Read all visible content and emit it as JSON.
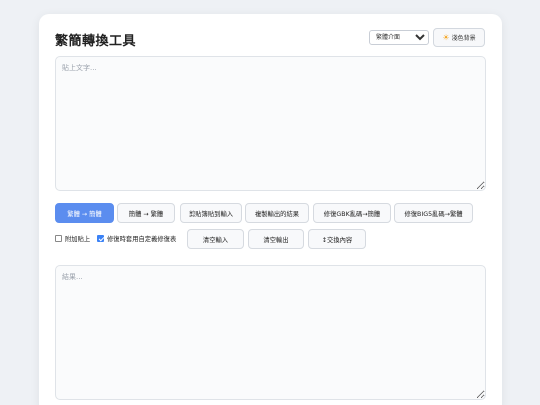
{
  "app": {
    "title": "繁簡轉換工具"
  },
  "header": {
    "mode_select": {
      "selected": "繁體介面",
      "options": [
        "繁體介面"
      ]
    },
    "theme_button": {
      "label": "淺色背景",
      "icon": "sun-icon",
      "icon_color": "#f5a623"
    }
  },
  "input": {
    "placeholder": "貼上文字...",
    "value": ""
  },
  "actions": {
    "trad_to_simp": "繁體 → 簡體",
    "simp_to_trad": "簡體 → 繁體",
    "paste_clipboard": "剪貼簿貼到輸入",
    "copy_output": "複製輸出的結果",
    "fix_gbk": "修復GBK亂碼→簡體",
    "fix_big5": "修復BIG5亂碼→繁體"
  },
  "options": {
    "append_paste": {
      "label": "附加貼上",
      "checked": false
    },
    "custom_table": {
      "label": "修復時套用自定義修復表",
      "checked": true
    }
  },
  "actions2": {
    "clear_input": "清空輸入",
    "clear_output": "清空輸出",
    "swap": "↕交換內容"
  },
  "output": {
    "placeholder": "結果...",
    "value": ""
  },
  "colors": {
    "primary": "#5b8def",
    "background": "#eef1f5",
    "card": "#ffffff"
  }
}
